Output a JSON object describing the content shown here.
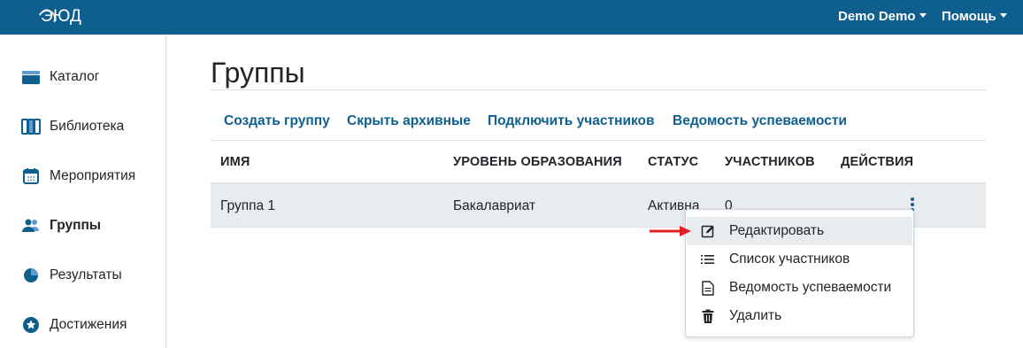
{
  "header": {
    "logo_text": "ЭЮД",
    "user_menu": "Demo Demo",
    "help_menu": "Помощь",
    "bar_color": "#0f5f8e"
  },
  "sidebar": {
    "items": [
      {
        "label": "Каталог",
        "icon": "catalog-icon"
      },
      {
        "label": "Библиотека",
        "icon": "library-icon"
      },
      {
        "label": "Мероприятия",
        "icon": "calendar-icon"
      },
      {
        "label": "Группы",
        "icon": "users-icon",
        "active": true
      },
      {
        "label": "Результаты",
        "icon": "pie-chart-icon"
      },
      {
        "label": "Достижения",
        "icon": "star-badge-icon"
      }
    ]
  },
  "main": {
    "title": "Группы",
    "actions": [
      "Создать группу",
      "Скрыть архивные",
      "Подключить участников",
      "Ведомость успеваемости"
    ],
    "table": {
      "columns": [
        "ИМЯ",
        "УРОВЕНЬ ОБРАЗОВАНИЯ",
        "СТАТУС",
        "УЧАСТНИКОВ",
        "ДЕЙСТВИЯ"
      ],
      "rows": [
        {
          "name": "Группа 1",
          "level": "Бакалавриат",
          "status": "Активна",
          "members": "0"
        }
      ]
    }
  },
  "dropdown": {
    "items": [
      {
        "label": "Редактировать",
        "icon": "edit-icon",
        "highlighted": true
      },
      {
        "label": "Список участников",
        "icon": "list-icon"
      },
      {
        "label": "Ведомость успеваемости",
        "icon": "document-icon"
      },
      {
        "label": "Удалить",
        "icon": "trash-icon"
      }
    ]
  },
  "colors": {
    "accent": "#0f5f8e",
    "arrow": "#e02020",
    "row_bg": "#e9ecef"
  }
}
